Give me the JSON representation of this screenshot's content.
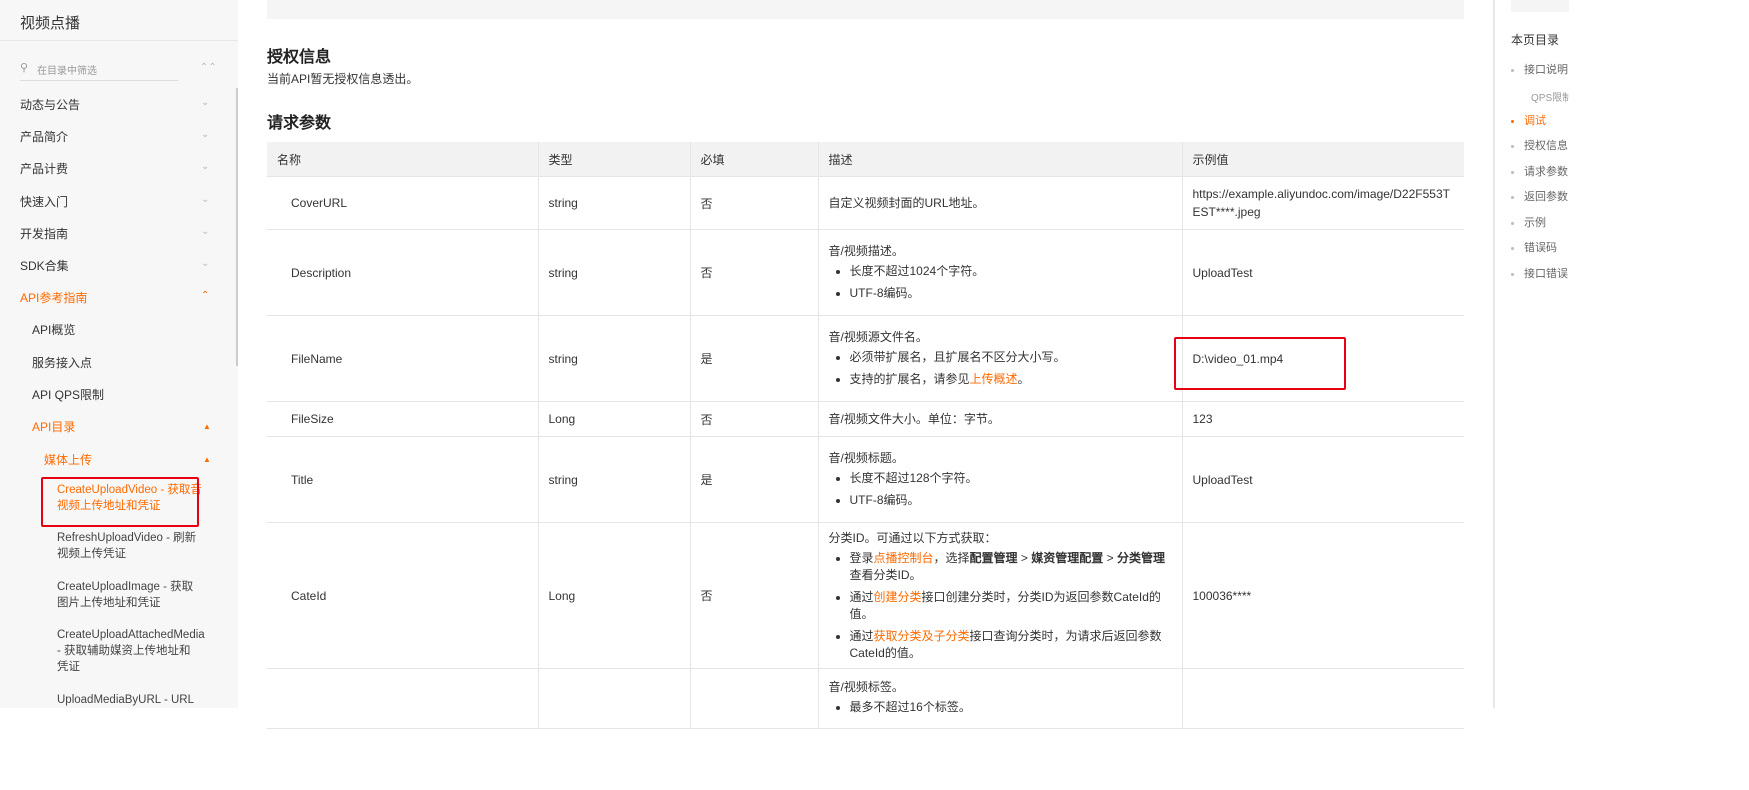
{
  "sidebar": {
    "brand": "视频点播",
    "filter_placeholder": "在目录中筛选",
    "items": [
      "动态与公告",
      "产品简介",
      "产品计费",
      "快速入门",
      "开发指南",
      "SDK合集",
      "API参考指南"
    ],
    "sub_items": [
      "API概览",
      "服务接入点",
      "API QPS限制",
      "API目录",
      "媒体上传"
    ],
    "api_list": [
      "CreateUploadVideo - 获取音视频上传地址和凭证",
      "RefreshUploadVideo - 刷新视频上传凭证",
      "CreateUploadImage - 获取图片上传地址和凭证",
      "CreateUploadAttachedMedia - 获取辅助媒资上传地址和凭证",
      "UploadMediaByURL - URL"
    ]
  },
  "main": {
    "auth_title": "授权信息",
    "auth_text": "当前API暂无授权信息透出。",
    "params_title": "请求参数",
    "table": {
      "headers": [
        "名称",
        "类型",
        "必填",
        "描述",
        "示例值"
      ],
      "rows": [
        {
          "name": "CoverURL",
          "type": "string",
          "required": "否",
          "desc": "自定义视频封面的URL地址。",
          "example": "https://example.aliyundoc.com/image/D22F553TEST****.jpeg"
        },
        {
          "name": "Description",
          "type": "string",
          "required": "否",
          "desc": "音/视频描述。",
          "bullets": [
            "长度不超过1024个字符。",
            "UTF-8编码。"
          ],
          "example": "UploadTest"
        },
        {
          "name": "FileName",
          "type": "string",
          "required": "是",
          "desc": "音/视频源文件名。",
          "bullets": [
            "必须带扩展名，且扩展名不区分大小写。"
          ],
          "bullet_pre": "支持的扩展名，请参见",
          "bullet_link": "上传概述",
          "bullet_post": "。",
          "example": "D:\\video_01.mp4"
        },
        {
          "name": "FileSize",
          "type": "Long",
          "required": "否",
          "desc": "音/视频文件大小。单位：字节。",
          "example": "123"
        },
        {
          "name": "Title",
          "type": "string",
          "required": "是",
          "desc": "音/视频标题。",
          "bullets": [
            "长度不超过128个字符。",
            "UTF-8编码。"
          ],
          "example": "UploadTest"
        },
        {
          "name": "CateId",
          "type": "Long",
          "required": "否",
          "desc": "分类ID。可通过以下方式获取：",
          "example": "100036****",
          "b1_pre": "登录",
          "b1_link": "点播控制台",
          "b1_mid": "，选择",
          "b1_bold1": "配置管理",
          "b1_gt1": " > ",
          "b1_bold2": "媒资管理配置",
          "b1_gt2": " > ",
          "b1_bold3": "分类管理",
          "b1_post": "查看分类ID。",
          "b2_pre": "通过",
          "b2_link": "创建分类",
          "b2_post": "接口创建分类时，分类ID为返回参数CateId的值。",
          "b3_pre": "通过",
          "b3_link": "获取分类及子分类",
          "b3_post": "接口查询分类时，为请求后返回参数CateId的值。"
        },
        {
          "name": "",
          "type": "",
          "required": "",
          "desc": "音/视频标签。",
          "bullets": [
            "最多不超过16个标签。"
          ],
          "example": ""
        }
      ]
    }
  },
  "toc": {
    "title": "本页目录",
    "items": [
      "接口说明",
      "QPS限制",
      "调试",
      "授权信息",
      "请求参数",
      "返回参数",
      "示例",
      "错误码",
      "接口错误"
    ]
  },
  "colors": {
    "accent": "#ff6a00",
    "highlight_box": "#e60012"
  }
}
